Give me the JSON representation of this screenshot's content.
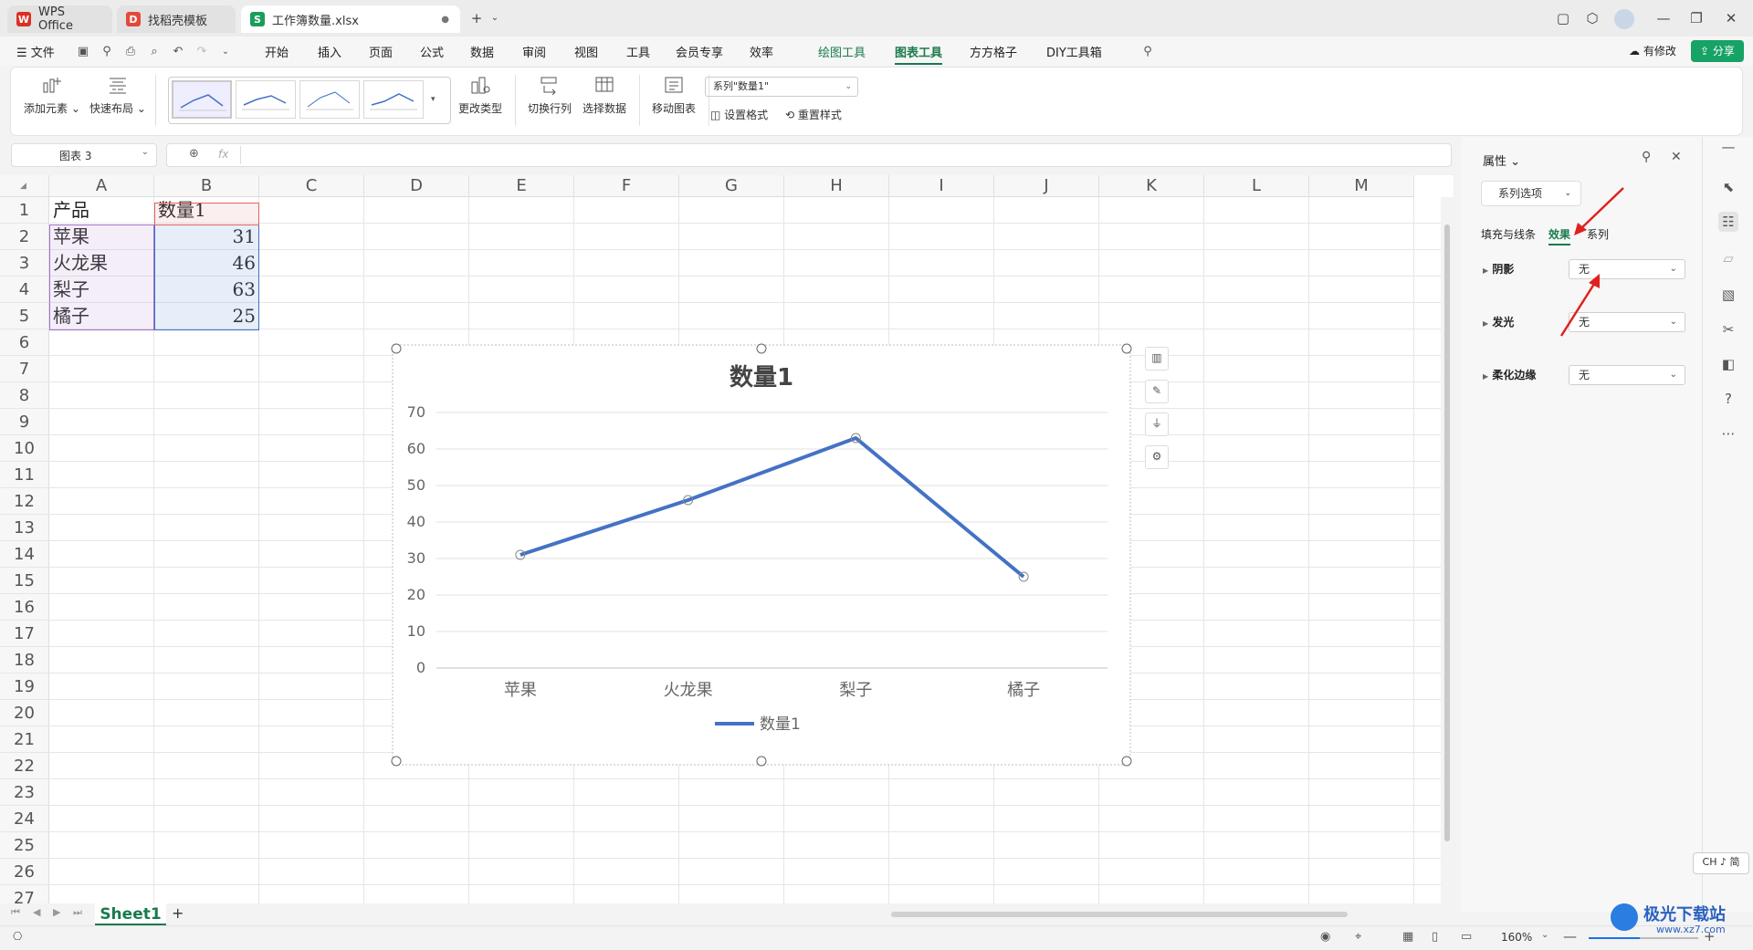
{
  "tabs": [
    {
      "label": "WPS Office",
      "icon": "wps-logo-icon"
    },
    {
      "label": "找稻壳模板",
      "icon": "docer-icon"
    },
    {
      "label": "工作簿数量.xlsx",
      "icon": "spreadsheet-icon"
    }
  ],
  "menu": {
    "file": "文件",
    "items": [
      "开始",
      "插入",
      "页面",
      "公式",
      "数据",
      "审阅",
      "视图",
      "工具",
      "会员专享",
      "效率",
      "绘图工具",
      "图表工具",
      "方方格子",
      "DIY工具箱"
    ],
    "active": "图表工具",
    "modified": "有修改",
    "share": "分享"
  },
  "ribbon": {
    "add_element": "添加元素",
    "quick_layout": "快速布局",
    "change_type": "更改类型",
    "switch_row_col": "切换行列",
    "select_data": "选择数据",
    "move_chart": "移动图表",
    "series_select": "系列\"数量1\"",
    "set_format": "设置格式",
    "reset_style": "重置样式"
  },
  "formula_bar": {
    "name_box": "图表 3",
    "fx": "fx",
    "content": ""
  },
  "sheet": {
    "columns": [
      "A",
      "B",
      "C",
      "D",
      "E",
      "F",
      "G",
      "H",
      "I",
      "J",
      "K",
      "L",
      "M"
    ],
    "rows": [
      "1",
      "2",
      "3",
      "4",
      "5",
      "6",
      "7",
      "8",
      "9",
      "10",
      "11",
      "12",
      "13",
      "14",
      "15",
      "16",
      "17",
      "18",
      "19",
      "20",
      "21",
      "22",
      "23",
      "24",
      "25",
      "26",
      "27"
    ],
    "cells": {
      "A1": "产品",
      "B1": "数量1",
      "A2": "苹果",
      "B2": "31",
      "A3": "火龙果",
      "B3": "46",
      "A4": "梨子",
      "B4": "63",
      "A5": "橘子",
      "B5": "25"
    },
    "tab": "Sheet1"
  },
  "chart_data": {
    "type": "line",
    "title": "数量1",
    "categories": [
      "苹果",
      "火龙果",
      "梨子",
      "橘子"
    ],
    "series": [
      {
        "name": "数量1",
        "values": [
          31,
          46,
          63,
          25
        ],
        "color": "#4472c4"
      }
    ],
    "ylim": [
      0,
      70
    ],
    "yticks": [
      "0",
      "10",
      "20",
      "30",
      "40",
      "50",
      "60",
      "70"
    ],
    "grid": true,
    "legend": "bottom"
  },
  "panel": {
    "title": "属性",
    "series_options": "系列选项",
    "tabs": [
      "填充与线条",
      "效果",
      "系列"
    ],
    "active_tab": "效果",
    "rows": [
      {
        "label": "阴影",
        "value": "无"
      },
      {
        "label": "发光",
        "value": "无"
      },
      {
        "label": "柔化边缘",
        "value": "无"
      }
    ]
  },
  "status": {
    "zoom": "160%",
    "ime": "CH ♪ 简"
  },
  "watermark": {
    "text": "极光下载站",
    "url": "www.xz7.com"
  },
  "colors": {
    "accent": "#1a7a4c",
    "series": "#4472c4",
    "arrow": "#e02020"
  }
}
